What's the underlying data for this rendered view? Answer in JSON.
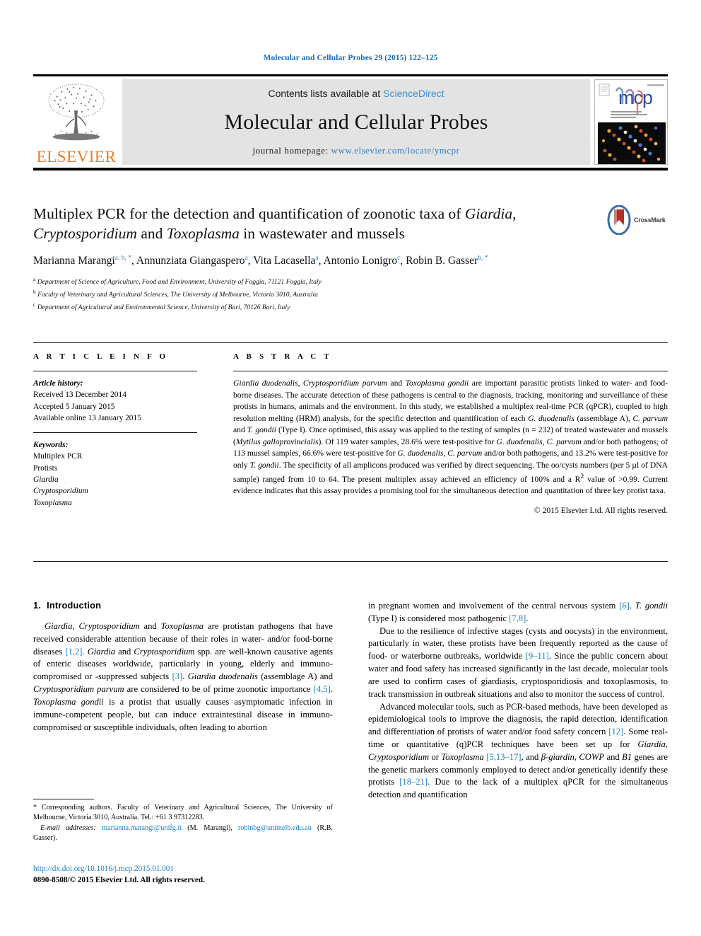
{
  "running_head": "Molecular and Cellular Probes 29 (2015) 122–125",
  "masthead": {
    "publisher": "ELSEVIER",
    "contents_prefix": "Contents lists available at ",
    "sciencedirect": "ScienceDirect",
    "journal_name": "Molecular and Cellular Probes",
    "homepage_prefix": "journal homepage: ",
    "homepage_url": "www.elsevier.com/locate/ymcpr",
    "cover_logo_text": "mcp",
    "cover_caption": "MOLECULAR AND CELLULAR PROBES"
  },
  "article": {
    "title_line1_pre": "Multiplex PCR for the detection and quantification of zoonotic taxa of ",
    "title_italic1": "Giardia",
    "title_mid1": ", ",
    "title_italic2": "Cryptosporidium",
    "title_mid2": " and ",
    "title_italic3": "Toxoplasma",
    "title_tail": " in wastewater and mussels",
    "crossmark_label": "CrossMark",
    "authors_text": "Marianna Marangi a, b, *, Annunziata Giangaspero a, Vita Lacasella a, Antonio Lonigro c, Robin B. Gasser b, *",
    "authors": [
      {
        "name": "Marianna Marangi",
        "sup": "a, b, *"
      },
      {
        "name": "Annunziata Giangaspero",
        "sup": "a"
      },
      {
        "name": "Vita Lacasella",
        "sup": "a"
      },
      {
        "name": "Antonio Lonigro",
        "sup": "c"
      },
      {
        "name": "Robin B. Gasser",
        "sup": "b, *"
      }
    ],
    "affiliations": [
      {
        "mark": "a",
        "text": "Department of Science of Agriculture, Food and Environment, University of Foggia, 71121 Foggia, Italy"
      },
      {
        "mark": "b",
        "text": "Faculty of Veterinary and Agricultural Sciences, The University of Melbourne, Victoria 3010, Australia"
      },
      {
        "mark": "c",
        "text": "Department of Agricultural and Environmental Science, University of Bari, 70126 Bari, Italy"
      }
    ]
  },
  "labels": {
    "article_info": "A R T I C L E   I N F O",
    "abstract": "A B S T R A C T"
  },
  "article_info": {
    "history_heading": "Article history:",
    "history": [
      "Received 13 December 2014",
      "Accepted 5 January 2015",
      "Available online 13 January 2015"
    ],
    "keywords_heading": "Keywords:",
    "keywords": [
      {
        "text": "Multiplex PCR",
        "italic": false
      },
      {
        "text": "Protists",
        "italic": false
      },
      {
        "text": "Giardia",
        "italic": true
      },
      {
        "text": "Cryptosporidium",
        "italic": true
      },
      {
        "text": "Toxoplasma",
        "italic": true
      }
    ]
  },
  "abstract": {
    "text": "Giardia duodenalis, Cryptosporidium parvum and Toxoplasma gondii are important parasitic protists linked to water- and food-borne diseases. The accurate detection of these pathogens is central to the diagnosis, tracking, monitoring and surveillance of these protists in humans, animals and the environment. In this study, we established a multiplex real-time PCR (qPCR), coupled to high resolution melting (HRM) analysis, for the specific detection and quantification of each G. duodenalis (assemblage A), C. parvum and T. gondii (Type I). Once optimised, this assay was applied to the testing of samples (n = 232) of treated wastewater and mussels (Mytilus galloprovincialis). Of 119 water samples, 28.6% were test-positive for G. duodenalis, C. parvum and/or both pathogens; of 113 mussel samples, 66.6% were test-positive for G. duodenalis, C. parvum and/or both pathogens, and 13.2% were test-positive for only T. gondii. The specificity of all amplicons produced was verified by direct sequencing. The oo/cysts numbers (per 5 µl of DNA sample) ranged from 10 to 64. The present multiplex assay achieved an efficiency of 100% and a R2 value of >0.99. Current evidence indicates that this assay provides a promising tool for the simultaneous detection and quantitation of three key protist taxa.",
    "copyright": "© 2015 Elsevier Ltd. All rights reserved."
  },
  "introduction": {
    "number": "1.",
    "heading": "Introduction",
    "left_paragraph": "Giardia, Cryptosporidium and Toxoplasma are protistan pathogens that have received considerable attention because of their roles in water- and/or food-borne diseases [1,2]. Giardia and Cryptosporidium spp. are well-known causative agents of enteric diseases worldwide, particularly in young, elderly and immuno-compromised or -suppressed subjects [3]. Giardia duodenalis (assemblage A) and Cryptosporidium parvum are considered to be of prime zoonotic importance [4,5]. Toxoplasma gondii is a protist that usually causes asymptomatic infection in immune-competent people, but can induce extraintestinal disease in immuno-compromised or susceptible individuals, often leading to abortion",
    "right_paragraph_1": "in pregnant women and involvement of the central nervous system [6]. T. gondii (Type I) is considered most pathogenic [7,8].",
    "right_paragraph_2": "Due to the resilience of infective stages (cysts and oocysts) in the environment, particularly in water, these protists have been frequently reported as the cause of food- or waterborne outbreaks, worldwide [9–11]. Since the public concern about water and food safety has increased significantly in the last decade, molecular tools are used to confirm cases of giardiasis, cryptosporidiosis and toxoplasmosis, to track transmission in outbreak situations and also to monitor the success of control.",
    "right_paragraph_3": "Advanced molecular tools, such as PCR-based methods, have been developed as epidemiological tools to improve the diagnosis, the rapid detection, identification and differentiation of protists of water and/or food safety concern [12]. Some real-time or quantitative (q)PCR techniques have been set up for Giardia, Cryptosporidium or Toxoplasma [5,13–17], and β-giardin, COWP and B1 genes are the genetic markers commonly employed to detect and/or genetically identify these protists [18–21]. Due to the lack of a multiplex qPCR for the simultaneous detection and quantification"
  },
  "footnotes": {
    "corresponding": "* Corresponding authors. Faculty of Veterinary and Agricultural Sciences, The University of Melbourne, Victoria 3010, Australia. Tel.: +61 3 97312283.",
    "email_label": "E-mail addresses:",
    "email_1": "marianna.marangi@unifg.it",
    "email_1_who": "(M. Marangi),",
    "email_2": "robinbg@unimelb.edu.au",
    "email_2_who": "(R.B. Gasser)."
  },
  "doi_block": {
    "doi_url": "http://dx.doi.org/10.1016/j.mcp.2015.01.001",
    "issn_line": "0890-8508/© 2015 Elsevier Ltd. All rights reserved."
  },
  "colors": {
    "link_blue": "#1a7fbd",
    "elsevier_orange": "#ec7b26",
    "masthead_grey": "#e3e3e3"
  }
}
